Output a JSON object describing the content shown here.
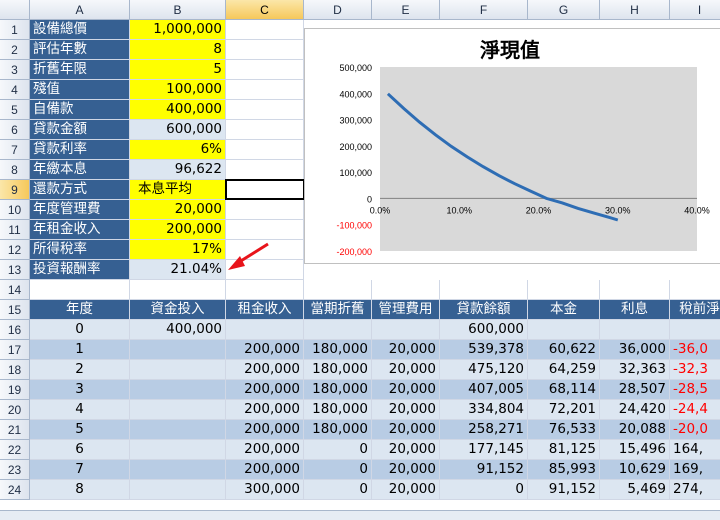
{
  "columns": [
    "A",
    "B",
    "C",
    "D",
    "E",
    "F",
    "G",
    "H",
    "I"
  ],
  "rows": [
    "1",
    "2",
    "3",
    "4",
    "5",
    "6",
    "7",
    "8",
    "9",
    "10",
    "11",
    "12",
    "13",
    "14",
    "15",
    "16",
    "17",
    "18",
    "19",
    "20",
    "21",
    "22",
    "23",
    "24"
  ],
  "params": [
    {
      "label": "設備總價",
      "value": "1,000,000",
      "style": "yel"
    },
    {
      "label": "評估年數",
      "value": "8",
      "style": "yel"
    },
    {
      "label": "折舊年限",
      "value": "5",
      "style": "yel"
    },
    {
      "label": "殘值",
      "value": "100,000",
      "style": "yel"
    },
    {
      "label": "自備款",
      "value": "400,000",
      "style": "yel"
    },
    {
      "label": "貸款金額",
      "value": "600,000",
      "style": "lt"
    },
    {
      "label": "貸款利率",
      "value": "6%",
      "style": "yel"
    },
    {
      "label": "年繳本息",
      "value": "96,622",
      "style": "lt"
    },
    {
      "label": "還款方式",
      "value": "本息平均",
      "style": "yel-left"
    },
    {
      "label": "年度管理費",
      "value": "20,000",
      "style": "yel"
    },
    {
      "label": "年租金收入",
      "value": "200,000",
      "style": "yel"
    },
    {
      "label": "所得稅率",
      "value": "17%",
      "style": "yel"
    },
    {
      "label": "投資報酬率",
      "value": "21.04%",
      "style": "lt"
    }
  ],
  "table_headers": [
    "年度",
    "資金投入",
    "租金收入",
    "當期折舊",
    "管理費用",
    "貸款餘額",
    "本金",
    "利息",
    "稅前淨"
  ],
  "table_rows": [
    [
      "0",
      "400,000",
      "",
      "",
      "",
      "600,000",
      "",
      "",
      ""
    ],
    [
      "1",
      "",
      "200,000",
      "180,000",
      "20,000",
      "539,378",
      "60,622",
      "36,000",
      "-36,0"
    ],
    [
      "2",
      "",
      "200,000",
      "180,000",
      "20,000",
      "475,120",
      "64,259",
      "32,363",
      "-32,3"
    ],
    [
      "3",
      "",
      "200,000",
      "180,000",
      "20,000",
      "407,005",
      "68,114",
      "28,507",
      "-28,5"
    ],
    [
      "4",
      "",
      "200,000",
      "180,000",
      "20,000",
      "334,804",
      "72,201",
      "24,420",
      "-24,4"
    ],
    [
      "5",
      "",
      "200,000",
      "180,000",
      "20,000",
      "258,271",
      "76,533",
      "20,088",
      "-20,0"
    ],
    [
      "6",
      "",
      "200,000",
      "0",
      "20,000",
      "177,145",
      "81,125",
      "15,496",
      "164,"
    ],
    [
      "7",
      "",
      "200,000",
      "0",
      "20,000",
      "91,152",
      "85,993",
      "10,629",
      "169,"
    ],
    [
      "8",
      "",
      "300,000",
      "0",
      "20,000",
      "0",
      "91,152",
      "5,469",
      "274,"
    ]
  ],
  "colors": {
    "header_blue": "#366092",
    "input_yellow": "#ffff00",
    "light_blue": "#dce6f1",
    "band_blue": "#b8cce4",
    "curve": "#2e6db4",
    "negative": "#ff0000",
    "arrow": "#e8141b"
  },
  "chart_data": {
    "type": "line",
    "title": "淨現值",
    "x": [
      0.01,
      0.03,
      0.05,
      0.07,
      0.09,
      0.11,
      0.13,
      0.15,
      0.17,
      0.19,
      0.21,
      0.23,
      0.25,
      0.27,
      0.29,
      0.3
    ],
    "y": [
      398000,
      342000,
      290000,
      242000,
      198000,
      158000,
      121000,
      87000,
      56000,
      28000,
      0,
      -17000,
      -38000,
      -56000,
      -73000,
      -82000
    ],
    "xticks": [
      "0.0%",
      "10.0%",
      "20.0%",
      "30.0%",
      "40.0%"
    ],
    "yticks": [
      "500,000",
      "400,000",
      "300,000",
      "200,000",
      "100,000",
      "0",
      "-100,000",
      "-200,000"
    ],
    "xlim": [
      0,
      0.4
    ],
    "ylim": [
      -200000,
      500000
    ],
    "grid": false,
    "legend": "none"
  }
}
